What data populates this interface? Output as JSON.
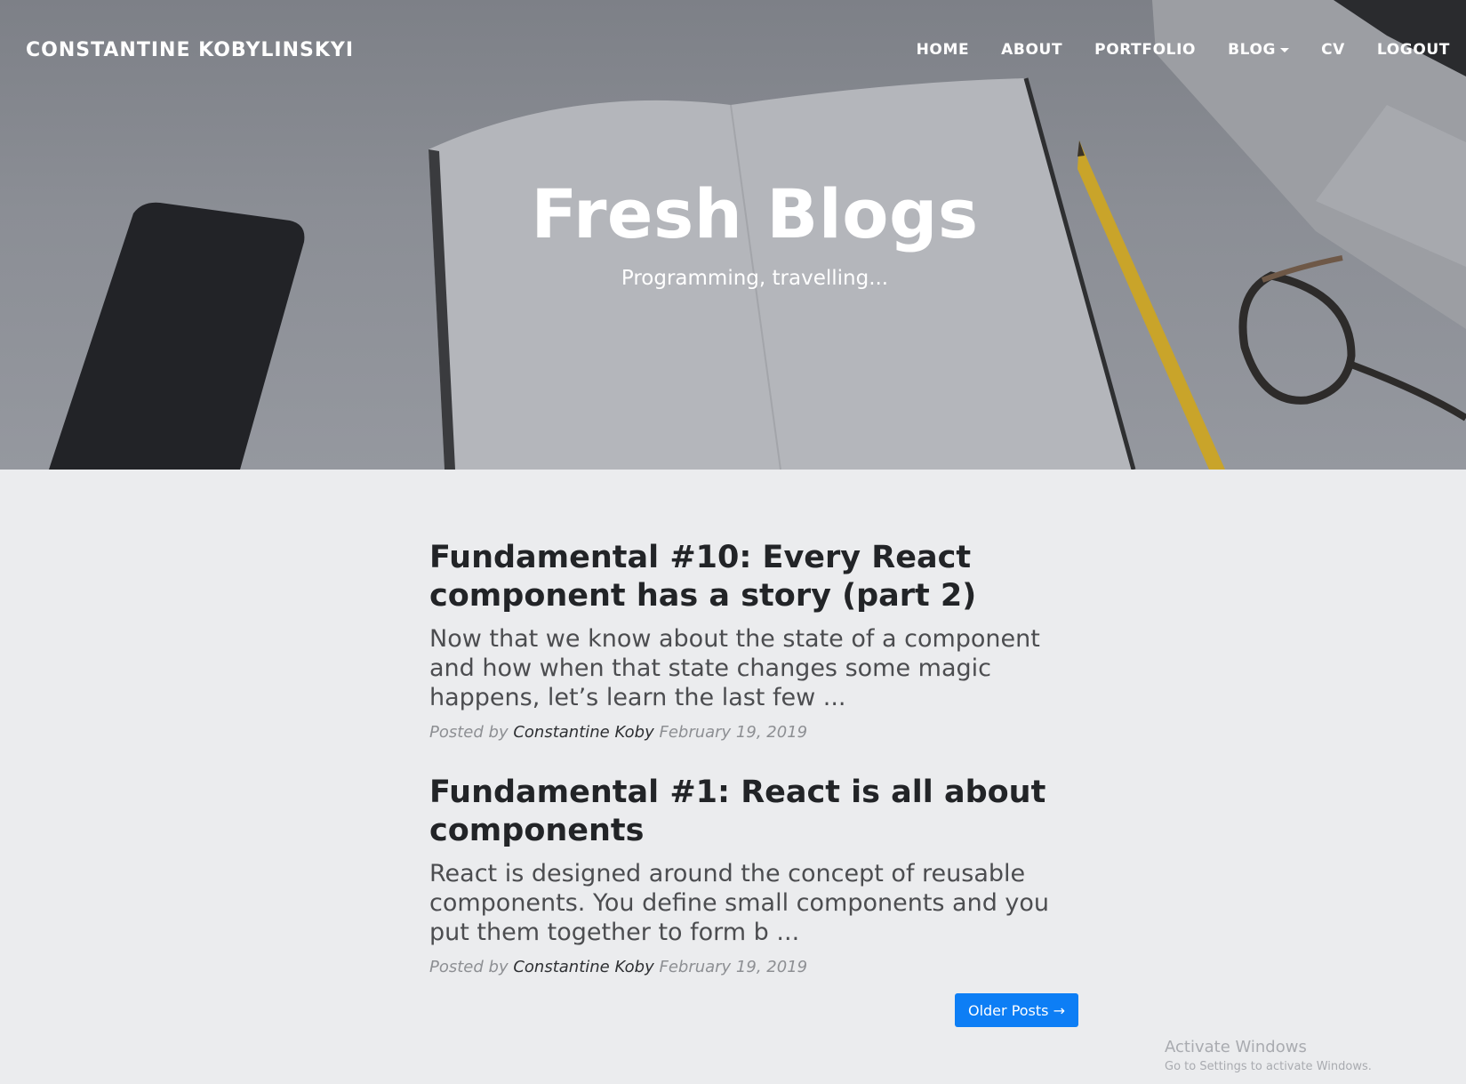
{
  "navbar": {
    "brand": "CONSTANTINE KOBYLINSKYI",
    "links": [
      {
        "label": "HOME"
      },
      {
        "label": "ABOUT"
      },
      {
        "label": "PORTFOLIO"
      },
      {
        "label": "BLOG",
        "has_dropdown": true
      },
      {
        "label": "CV"
      },
      {
        "label": "LOGOUT"
      }
    ]
  },
  "hero": {
    "title": "Fresh Blogs",
    "subtitle": "Programming, travelling..."
  },
  "posts": [
    {
      "title": "Fundamental #10: Every React component has a story (part 2)",
      "excerpt": "Now that we know about the state of a component and how when that state changes some magic happens, let’s learn the last few ...",
      "meta_prefix": "Posted by",
      "author": "Constantine Koby",
      "date": "February 19, 2019"
    },
    {
      "title": "Fundamental #1: React is all about components",
      "excerpt": "React is designed around the concept of reusable components. You define small components and you put them together to form b ...",
      "meta_prefix": "Posted by",
      "author": "Constantine Koby",
      "date": "February 19, 2019"
    }
  ],
  "pagination": {
    "older_label": "Older Posts →"
  },
  "watermark": {
    "title": "Activate Windows",
    "subtitle": "Go to Settings to activate Windows."
  },
  "colors": {
    "accent": "#0d7ef5",
    "hero_overlay": "#80838a",
    "page_bg": "#ebecee"
  }
}
